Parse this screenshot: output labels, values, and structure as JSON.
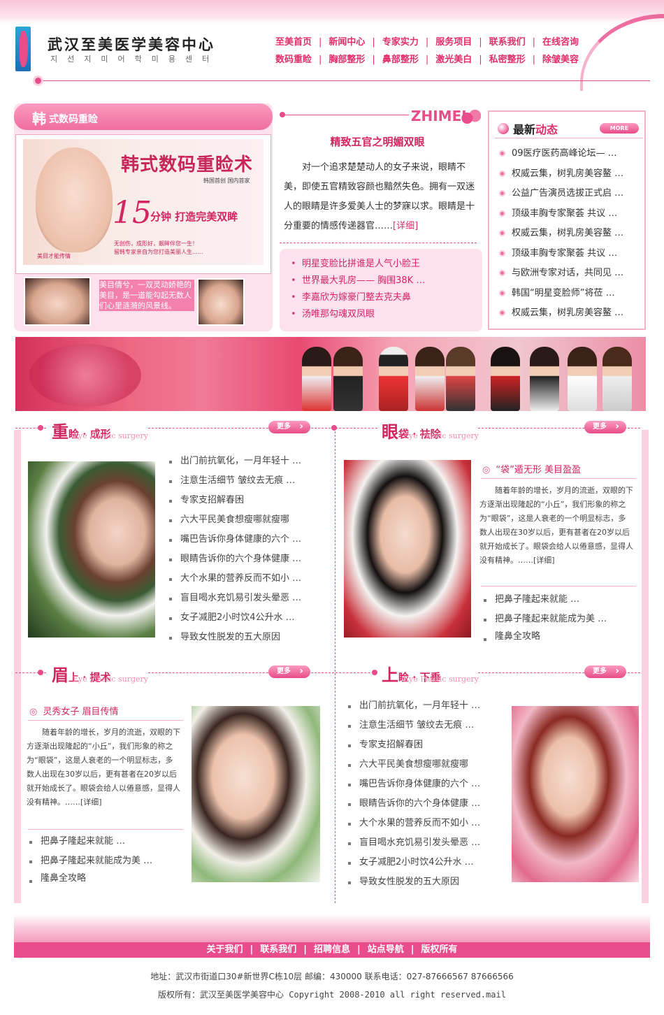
{
  "header": {
    "logo_title": "武汉至美医学美容中心",
    "logo_subtitle": "지선지미어학미용센터",
    "nav_row1": [
      "至美首页",
      "新闻中心",
      "专家实力",
      "服务项目",
      "联系我们",
      "在线咨询"
    ],
    "nav_row2": [
      "数码重睑",
      "胸部整形",
      "鼻部整形",
      "激光美白",
      "私密整形",
      "除皱美容"
    ]
  },
  "feature": {
    "head_big": "韩",
    "head_small": "式数码重睑",
    "banner_title": "韩式数码重睑术",
    "banner_small": "韩国首创  国内首家",
    "banner_number": "15",
    "banner_minutes": "分钟 打造完美双眸",
    "banner_line1": "无创伤，成形好，靓眸伴您一生！",
    "banner_line2": "留韩专家亲自为您打造美丽人生……",
    "banner_brand": "美目才能传情",
    "thumb_text": "美目倩兮，一双灵动娇艳的美目，是一道能勾起无数人们心里涟漪的风景线。"
  },
  "middle": {
    "brand": "ZHIMEI",
    "title": "精致五官之明媚双眼",
    "text": "对一个追求楚楚动人的女子来说，眼睛不美，即使五官精致容颜也黯然失色。拥有一双迷人的眼睛是许多爱美人士的梦寐以求。眼睛是十分重要的情感传递器官……",
    "detail_link": "[详细]",
    "links": [
      "明星变脸比拼谁是人气小脸王",
      "世界最大乳房——  胸围38K  …",
      "李嘉欣为嫁豪门整去克夫鼻",
      "汤唯那勾魂双凤眼"
    ]
  },
  "news": {
    "title_a": "最新",
    "title_b": "动态",
    "more": "MORE",
    "items": [
      "09医疗医药高峰论坛— …",
      "权威云集，树乳房美容鳌 …",
      "公益广告演员选拔正式启 …",
      "顶级丰胸专家聚荟  共议 …",
      "权威云集，树乳房美容鳌 …",
      "顶级丰胸专家聚荟  共议 …",
      "与欧洲专家对话，共同见 …",
      "韩国“明星变脸师”将莅 …",
      "权威云集，树乳房美容鳌 …"
    ]
  },
  "sections": {
    "s1": {
      "big": "重",
      "rest": "睑 · 成形",
      "sub": "Eye Plastic surgery",
      "more": "更多",
      "items": [
        "出门前抗氧化，一月年轻十 …",
        "注意生活细节  皱纹去无痕 …",
        "专家支招解春困",
        "六大平民美食想瘦哪就瘦哪",
        "嘴巴告诉你身体健康的六个 …",
        "眼睛告诉你的六个身体健康 …",
        "大个水果的营养反而不如小 …",
        "盲目喝水充饥易引发头晕恶 …",
        "女子减肥2小时饮4公升水 …",
        "导致女性脱发的五大原因"
      ]
    },
    "s2": {
      "big": "眼",
      "rest": "袋 · 祛除",
      "sub": "Eye Plastic surgery",
      "more": "更多",
      "headline": "“袋”遁无形  美目盈盈",
      "para": "随着年龄的增长，岁月的流逝，双眼的下方逐渐出现隆起的“小丘”，我们形象的称之为“眼袋”，这是人衰老的一个明显标志，多数人出现在30岁以后，更有甚者在20岁以后就开始成长了。眼袋会给人以倦意感，显得人没有精神。……[详细]",
      "items": [
        "把鼻子隆起来就能 …",
        "把鼻子隆起来就能成为美 …",
        "隆鼻全攻略"
      ]
    },
    "s3": {
      "big": "眉",
      "rest": "上 · 提术",
      "sub": "Eye Plastic surgery",
      "more": "更多",
      "headline": "灵秀女子  眉目传情",
      "para": "随着年龄的增长，岁月的流逝，双眼的下方逐渐出现隆起的“小丘”，我们形象的称之为“眼袋”，这是人衰老的一个明显标志，多数人出现在30岁以后，更有甚者在20岁以后就开始成长了。眼袋会给人以倦意感，显得人没有精神。……[详细]",
      "items": [
        "把鼻子隆起来就能 …",
        "把鼻子隆起来就能成为美 …",
        "隆鼻全攻略"
      ]
    },
    "s4": {
      "big": "上",
      "rest": "睑 · 下垂",
      "sub": "Eye Plastic surgery",
      "more": "更多",
      "items": [
        "出门前抗氧化，一月年轻十 …",
        "注意生活细节  皱纹去无痕 …",
        "专家支招解春困",
        "六大平民美食想瘦哪就瘦哪",
        "嘴巴告诉你身体健康的六个 …",
        "眼睛告诉你的六个身体健康 …",
        "大个水果的营养反而不如小 …",
        "盲目喝水充饥易引发头晕恶 …",
        "女子减肥2小时饮4公升水 …",
        "导致女性脱发的五大原因"
      ]
    }
  },
  "footer": {
    "links": [
      "关于我们",
      "联系我们",
      "招聘信息",
      "站点导航",
      "版权所有"
    ],
    "address": "地址：武汉市街道口30#新世界C栋10层   邮编：430000   联系电话：027-87666567 87666566",
    "copyright": "版权所有：武汉至美医学美容中心 Copyright 2008-2010 all right reserved.mail"
  },
  "colors": {
    "accent": "#e94c8a",
    "accent_dark": "#d22662",
    "light_pink": "#fde1ec"
  }
}
